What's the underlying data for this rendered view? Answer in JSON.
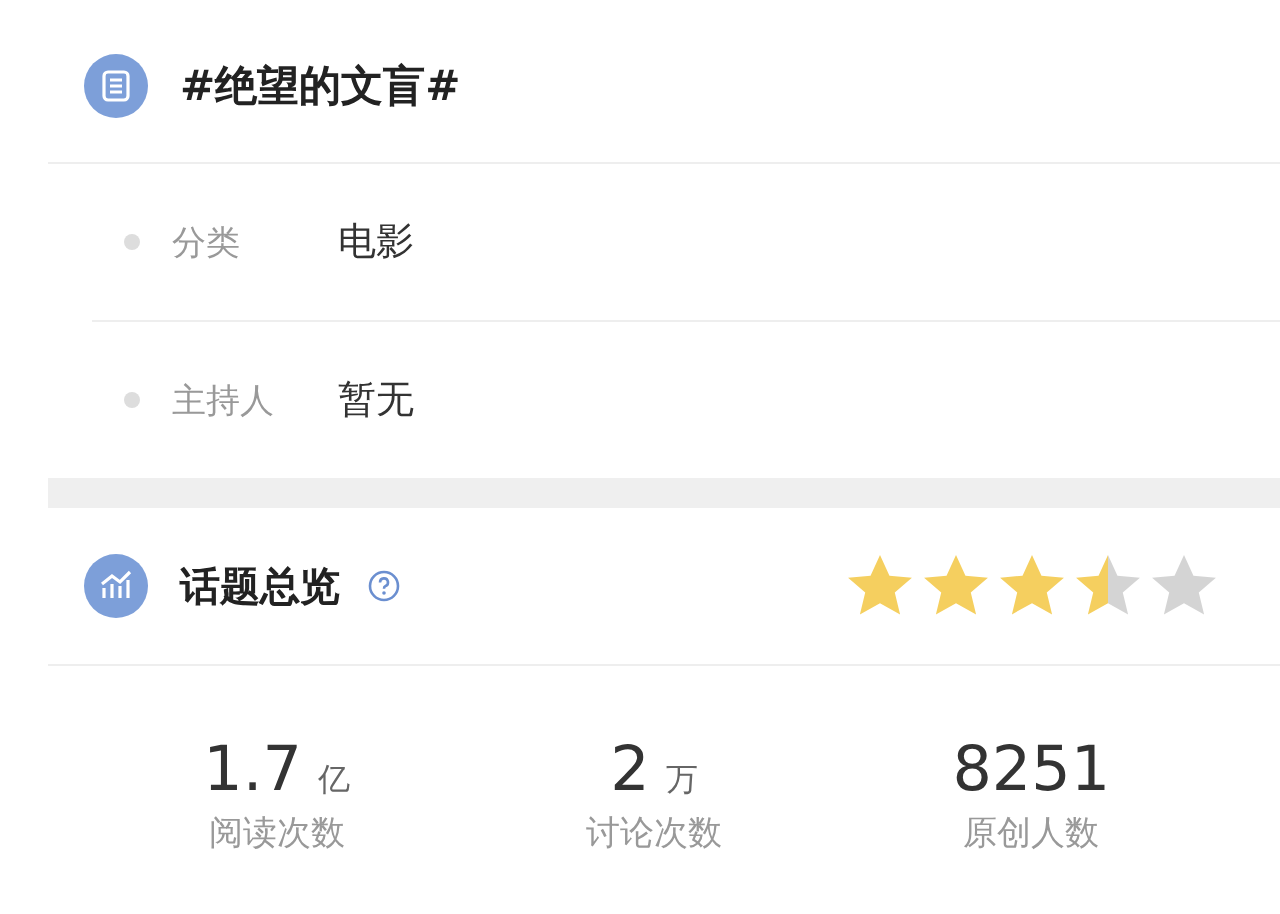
{
  "topic": {
    "title": "#绝望的文盲#"
  },
  "info_rows": [
    {
      "label": "分类",
      "value": "电影"
    },
    {
      "label": "主持人",
      "value": "暂无"
    }
  ],
  "overview": {
    "title": "话题总览",
    "stars": 3.5
  },
  "stats": [
    {
      "number": "1.7",
      "unit": "亿",
      "label": "阅读次数"
    },
    {
      "number": "2",
      "unit": "万",
      "label": "讨论次数"
    },
    {
      "number": "8251",
      "label": "原创人数"
    }
  ]
}
